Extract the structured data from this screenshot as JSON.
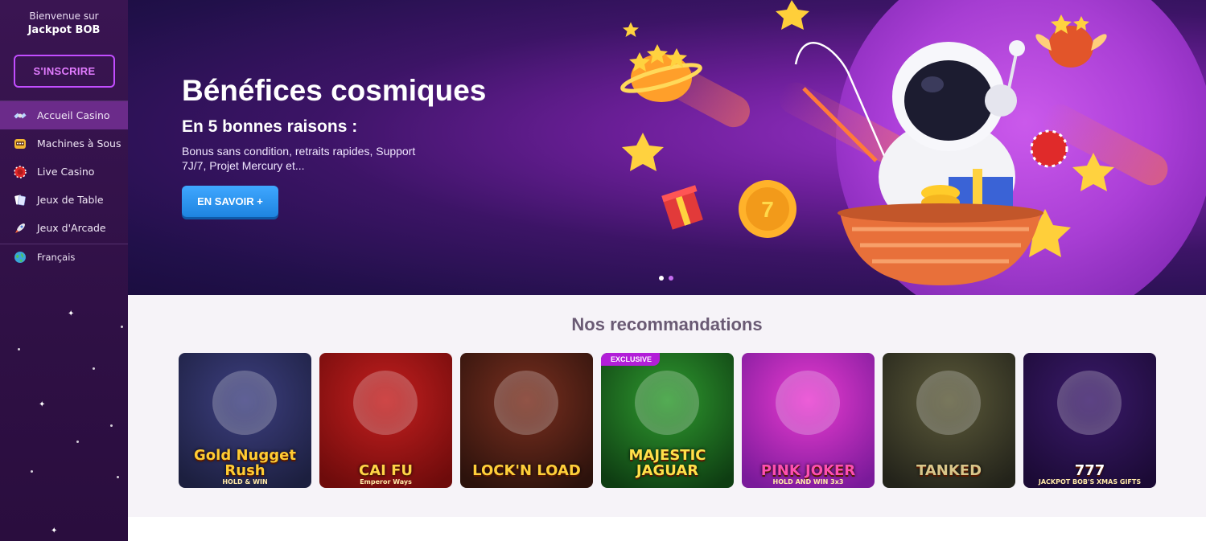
{
  "sidebar": {
    "welcome_line1": "Bienvenue sur",
    "welcome_line2": "Jackpot BOB",
    "signup_label": "S'INSCRIRE",
    "items": [
      {
        "label": "Accueil Casino",
        "icon": "satellite-icon",
        "active": true
      },
      {
        "label": "Machines à Sous",
        "icon": "slot-machine-icon",
        "active": false
      },
      {
        "label": "Live Casino",
        "icon": "roulette-chip-icon",
        "active": false
      },
      {
        "label": "Jeux de Table",
        "icon": "cards-icon",
        "active": false
      },
      {
        "label": "Jeux d'Arcade",
        "icon": "rocket-icon",
        "active": false
      }
    ],
    "language": {
      "label": "Français",
      "icon": "globe-icon"
    }
  },
  "hero": {
    "title": "Bénéfices cosmiques",
    "subtitle": "En 5 bonnes raisons :",
    "description": "Bonus sans condition, retraits rapides, Support 7J/7, Projet Mercury et...",
    "button_label": "EN SAVOIR +",
    "slides_count": 2,
    "active_slide": 2
  },
  "recommendations": {
    "title": "Nos recommandations",
    "games": [
      {
        "name": "Gold Nugget Rush",
        "sub": "HOLD & WIN",
        "badge": "",
        "bg1": "#3d3f80",
        "bg2": "#1c1f3f",
        "text": "#ffcc33"
      },
      {
        "name": "CAI FU",
        "sub": "Emperor Ways",
        "badge": "",
        "bg1": "#c41f1f",
        "bg2": "#6e0b0b",
        "text": "#ffd447"
      },
      {
        "name": "LOCK'N LOAD",
        "sub": "",
        "badge": "",
        "bg1": "#7a2f1f",
        "bg2": "#2c120c",
        "text": "#ffcf3a"
      },
      {
        "name": "MAJESTIC JAGUAR",
        "sub": "",
        "badge": "EXCLUSIVE",
        "bg1": "#2f9a2f",
        "bg2": "#0e3d12",
        "text": "#ffe14a"
      },
      {
        "name": "PINK JOKER",
        "sub": "HOLD AND WIN 3x3",
        "badge": "",
        "bg1": "#e93bd0",
        "bg2": "#7a1a9a",
        "text": "#ff4fb0"
      },
      {
        "name": "TANKED",
        "sub": "",
        "badge": "",
        "bg1": "#5c5a3a",
        "bg2": "#23231a",
        "text": "#d8c68a"
      },
      {
        "name": "777",
        "sub": "JACKPOT BOB'S XMAS GIFTS",
        "badge": "",
        "bg1": "#3a1a6a",
        "bg2": "#1b0a35",
        "text": "#ffffff"
      }
    ]
  },
  "colors": {
    "sidebar_bg": "#2f1045",
    "active_item": "#6b2b8a",
    "signup_border": "#c24dff",
    "hero_button": "#1e84e0",
    "reco_bg": "#f6f3f8"
  }
}
